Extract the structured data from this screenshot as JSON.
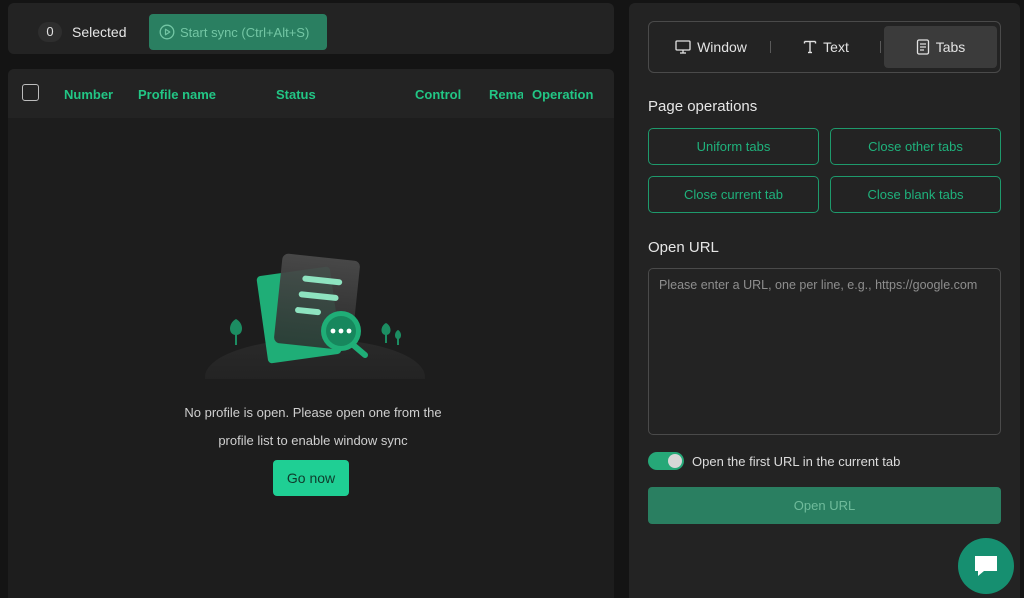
{
  "topbar": {
    "selected_count": "0",
    "selected_label": "Selected",
    "start_sync_label": "Start sync (Ctrl+Alt+S)"
  },
  "table": {
    "columns": [
      "Number",
      "Profile name",
      "Status",
      "Control",
      "Rema",
      "Operation"
    ],
    "empty_line1": "No profile is open. Please open one from the",
    "empty_line2": "profile list to enable window sync",
    "go_now_label": "Go now"
  },
  "right_panel": {
    "tabs": [
      {
        "label": "Window",
        "icon": "monitor-icon"
      },
      {
        "label": "Text",
        "icon": "text-icon"
      },
      {
        "label": "Tabs",
        "icon": "document-icon"
      }
    ],
    "active_tab": "Tabs",
    "page_operations_title": "Page operations",
    "operations": [
      "Uniform tabs",
      "Close other tabs",
      "Close current tab",
      "Close blank tabs"
    ],
    "open_url_title": "Open URL",
    "url_placeholder": "Please enter a URL, one per line, e.g., https://google.com",
    "toggle_label": "Open the first URL in the current tab",
    "toggle_on": true,
    "open_url_button": "Open URL"
  },
  "colors": {
    "accent": "#22c685",
    "accent_dim": "#2a7f61",
    "panel": "#232323",
    "background": "#141414"
  }
}
